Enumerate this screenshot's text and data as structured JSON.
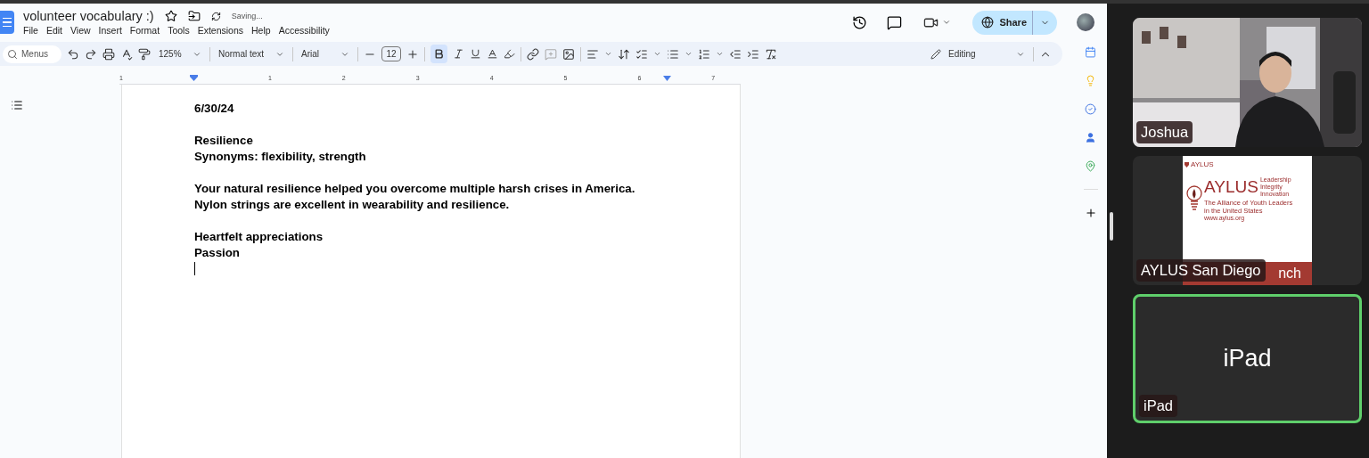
{
  "document": {
    "title": "volunteer vocabulary :)",
    "starred": false,
    "save_status": "Saving...",
    "menus": [
      "File",
      "Edit",
      "View",
      "Insert",
      "Format",
      "Tools",
      "Extensions",
      "Help",
      "Accessibility"
    ],
    "share_label": "Share",
    "toolbar": {
      "search_placeholder": "Menus",
      "zoom": "125%",
      "style": "Normal text",
      "font": "Arial",
      "font_size": "12",
      "bold": true,
      "mode": "Editing"
    },
    "ruler_labels": [
      "1",
      "1",
      "2",
      "3",
      "4",
      "5",
      "6",
      "7"
    ],
    "paragraphs": [
      [
        "6/30/24"
      ],
      [
        "Resilience",
        "Synonyms: flexibility, strength"
      ],
      [
        "Your natural resilience helped you overcome multiple harsh crises in America.",
        "Nylon strings are excellent in wearability and resilience."
      ],
      [
        "Heartfelt appreciations",
        "Passion"
      ]
    ],
    "cursor": true
  },
  "participants": [
    {
      "name": "Joshua",
      "kind": "camera",
      "speaking": false
    },
    {
      "name": "AYLUS San Diego",
      "kind": "slide",
      "speaking": false,
      "slide": {
        "header": "AYLUS",
        "logo": "AYLUS",
        "tagline": [
          "Leadership",
          "Integrity",
          "Innovation"
        ],
        "lines": [
          "The Alliance of Youth Leaders",
          "in the United States"
        ],
        "url": "www.aylus.org",
        "band": "nch"
      }
    },
    {
      "name": "iPad",
      "kind": "avatar",
      "speaking": true,
      "display_name": "iPad"
    }
  ]
}
